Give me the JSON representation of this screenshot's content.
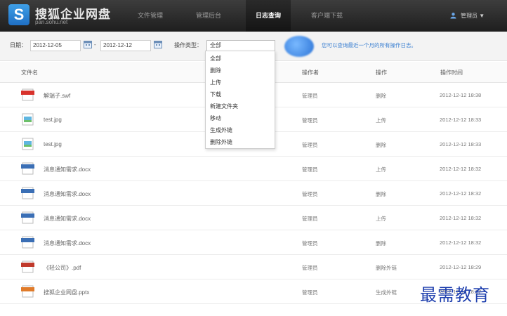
{
  "brand": {
    "logo_letter": "S",
    "name": "搜狐企业网盘",
    "domain": "pan.sohu.net"
  },
  "nav": [
    {
      "label": "文件管理",
      "active": false
    },
    {
      "label": "管理后台",
      "active": false
    },
    {
      "label": "日志查询",
      "active": true
    },
    {
      "label": "客户端下载",
      "active": false
    }
  ],
  "user": {
    "label": "管理员 ▼"
  },
  "filter": {
    "date_label": "日期：",
    "date_from": "2012-12-05",
    "date_sep": "-",
    "date_to": "2012-12-12",
    "op_label": "操作类型：",
    "op_selected": "全部",
    "hint": "您可以查询最近一个月的所有操作日志。"
  },
  "dropdown": {
    "options": [
      "全部",
      "删除",
      "上传",
      "下载",
      "新建文件夹",
      "移动",
      "生成外链",
      "删除外链"
    ]
  },
  "table": {
    "headers": {
      "name": "文件名",
      "operator": "操作者",
      "action": "操作",
      "time": "操作时间"
    },
    "rows": [
      {
        "icon": "swf-file-icon",
        "name": "解端子.swf",
        "operator": "管理员",
        "action": "删除",
        "time": "2012-12-12 18:38"
      },
      {
        "icon": "image-file-icon",
        "name": "test.jpg",
        "operator": "管理员",
        "action": "上传",
        "time": "2012-12-12 18:33"
      },
      {
        "icon": "image-file-icon",
        "name": "test.jpg",
        "operator": "管理员",
        "action": "删除",
        "time": "2012-12-12 18:33"
      },
      {
        "icon": "docx-file-icon",
        "name": "消息通知需求.docx",
        "operator": "管理员",
        "action": "上传",
        "time": "2012-12-12 18:32"
      },
      {
        "icon": "docx-file-icon",
        "name": "消息通知需求.docx",
        "operator": "管理员",
        "action": "删除",
        "time": "2012-12-12 18:32"
      },
      {
        "icon": "docx-file-icon",
        "name": "消息通知需求.docx",
        "operator": "管理员",
        "action": "上传",
        "time": "2012-12-12 18:32"
      },
      {
        "icon": "docx-file-icon",
        "name": "消息通知需求.docx",
        "operator": "管理员",
        "action": "删除",
        "time": "2012-12-12 18:32"
      },
      {
        "icon": "pdf-file-icon",
        "name": "《轻公司》.pdf",
        "operator": "管理员",
        "action": "删除外链",
        "time": "2012-12-12 18:29"
      },
      {
        "icon": "pptx-file-icon",
        "name": "搜狐企业网盘.pptx",
        "operator": "管理员",
        "action": "生成外链",
        "time": "2012-12-12 18:27"
      }
    ]
  },
  "watermark": "最需教育",
  "colors": {
    "topbar": "#2b2b2b",
    "accent": "#3a7fd1",
    "watermark": "#1e3fae"
  }
}
